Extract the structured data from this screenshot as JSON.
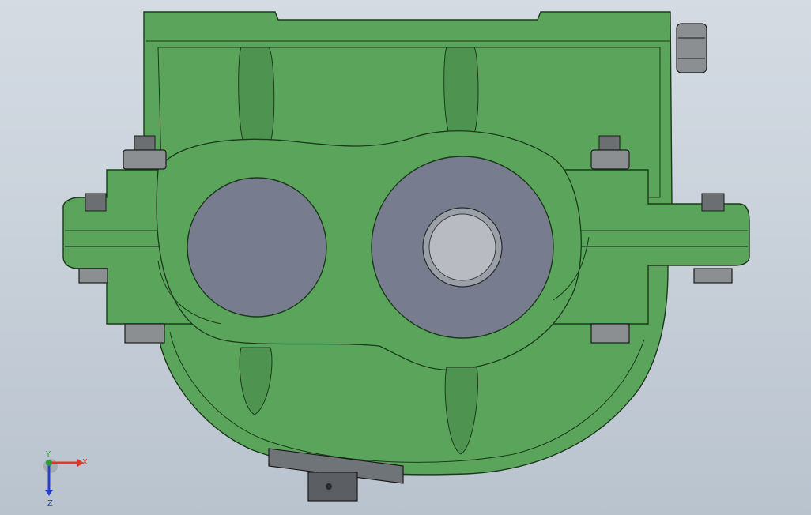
{
  "viewport": {
    "background_top": "#d4dbe3",
    "background_bottom": "#b9c3ce"
  },
  "model": {
    "housing_color": "#5aa55b",
    "housing_shadow": "#4e9450",
    "edge_color": "#1c3a1c",
    "bore_color": "#777c8e",
    "shaft_color": "#b8bcc2",
    "fastener_color": "#8c8f92"
  },
  "triad": {
    "x_label": "X",
    "y_label": "Y",
    "z_label": "Z",
    "x_color": "#d93a2a",
    "y_color": "#2f9a3a",
    "z_color": "#2a3fc8"
  }
}
